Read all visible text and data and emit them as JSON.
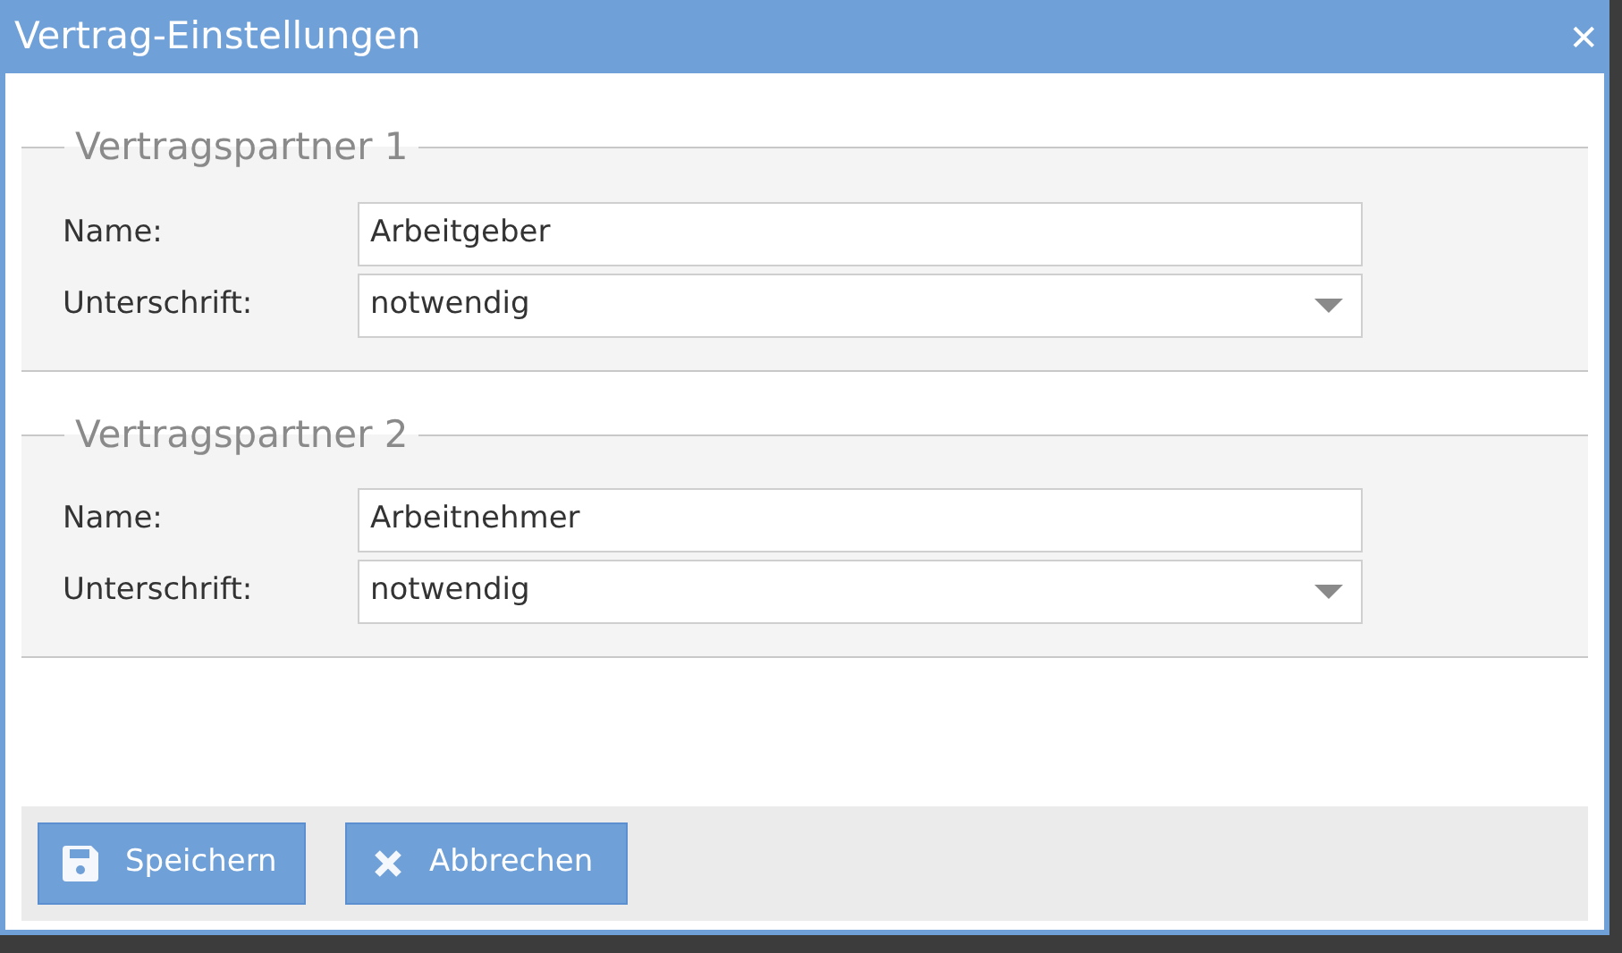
{
  "window": {
    "title": "Vertrag-Einstellungen",
    "close": "✕"
  },
  "sections": [
    {
      "legend": "Vertragspartner 1",
      "fields": [
        {
          "kind": "text",
          "label": "Name:",
          "value": "Arbeitgeber"
        },
        {
          "kind": "select",
          "label": "Unterschrift:",
          "value": "notwendig"
        }
      ]
    },
    {
      "legend": "Vertragspartner 2",
      "fields": [
        {
          "kind": "text",
          "label": "Name:",
          "value": "Arbeitnehmer"
        },
        {
          "kind": "select",
          "label": "Unterschrift:",
          "value": "notwendig"
        }
      ]
    }
  ],
  "buttons": [
    {
      "kind": "save",
      "label": "Speichern"
    },
    {
      "kind": "cancel",
      "label": "Abbrechen"
    }
  ]
}
